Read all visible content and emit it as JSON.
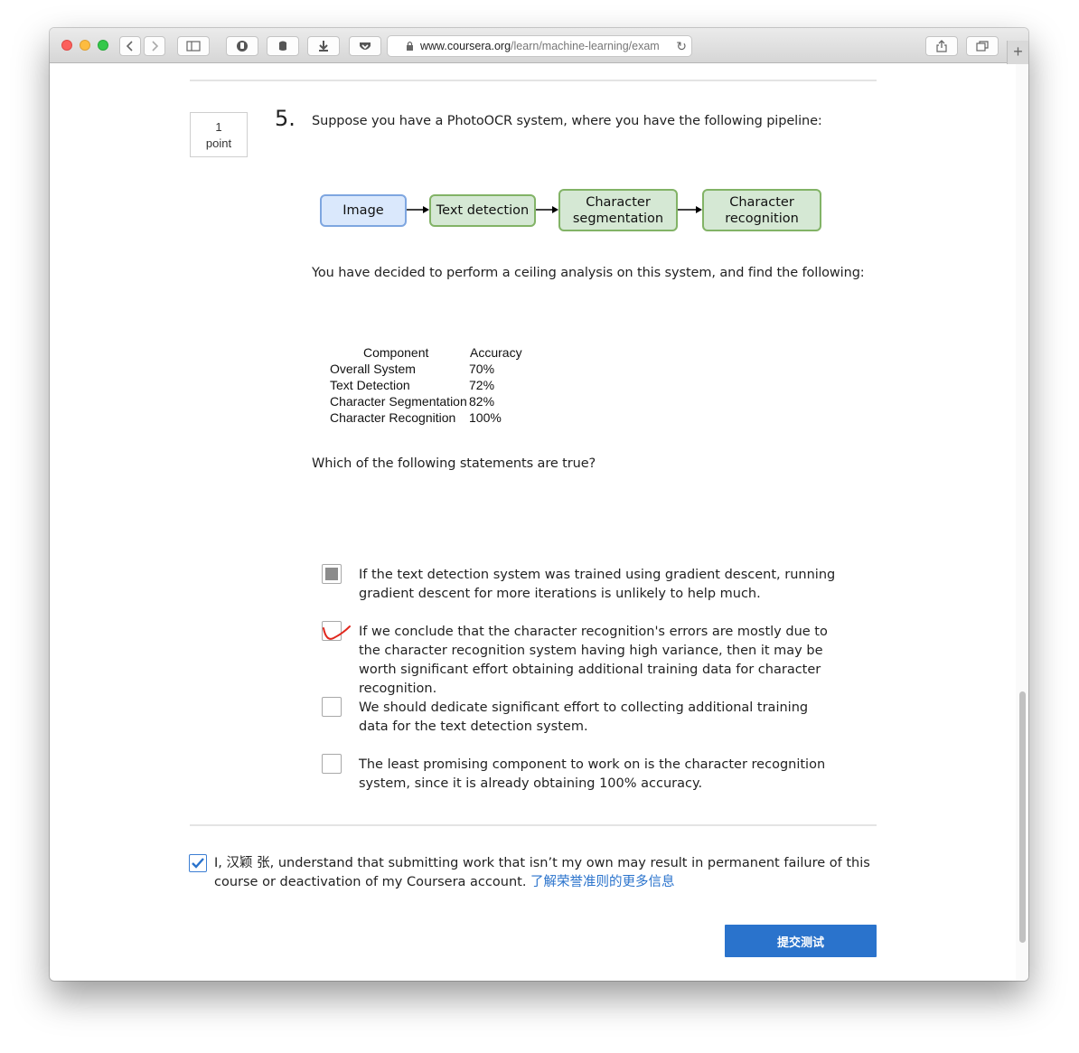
{
  "browser": {
    "url_host": "www.coursera.org",
    "url_path": "/learn/machine-learning/exam"
  },
  "question": {
    "points_value": "1",
    "points_label": "point",
    "number": "5.",
    "intro": "Suppose you have a PhotoOCR system, where you have the following pipeline:",
    "pipeline": {
      "image": "Image",
      "text_detection": "Text detection",
      "char_seg_1": "Character",
      "char_seg_2": "segmentation",
      "char_rec_1": "Character",
      "char_rec_2": "recognition"
    },
    "analysis_text": "You have decided to perform a ceiling analysis on this system, and find the following:",
    "table": {
      "header_component": "Component",
      "header_accuracy": "Accuracy",
      "rows": [
        {
          "component": "Overall System",
          "accuracy": "70%"
        },
        {
          "component": "Text Detection",
          "accuracy": "72%"
        },
        {
          "component": "Character Segmentation",
          "accuracy": "82%"
        },
        {
          "component": "Character Recognition",
          "accuracy": "100%"
        }
      ]
    },
    "prompt": "Which of the following statements are true?",
    "options": [
      {
        "text": "If the text detection system was trained using gradient descent, running gradient descent for more iterations is unlikely to help much.",
        "state": "partial"
      },
      {
        "text": "If we conclude that the character recognition's errors are mostly due to the character recognition system having high variance, then it may be worth significant effort obtaining additional training data for character recognition.",
        "state": "correct-mark"
      },
      {
        "text": "We should dedicate significant effort to collecting additional training data for the text detection system.",
        "state": "unchecked"
      },
      {
        "text": "The least promising component to work on is the character recognition system, since it is already obtaining 100% accuracy.",
        "state": "unchecked"
      }
    ]
  },
  "honor": {
    "text": "I, 汉颖 张, understand that submitting work that isn’t my own may result in permanent failure of this course or deactivation of my Coursera account.",
    "link": "了解荣誉准则的更多信息",
    "checked": true
  },
  "submit_label": "提交测试",
  "colors": {
    "accent": "#2a73cc",
    "image_box_fill": "#dae8fc",
    "stage_box_fill": "#d5e8d4",
    "mark_red": "#e0281e"
  }
}
